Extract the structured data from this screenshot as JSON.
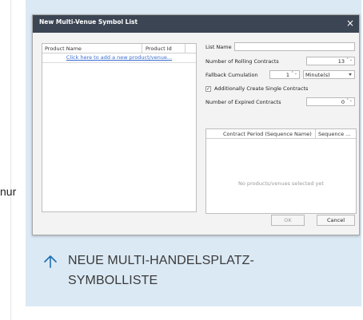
{
  "background": {
    "panel_color": "#dbe9f4",
    "cut_text": "nur"
  },
  "dialog": {
    "title": "New Multi-Venue Symbol List",
    "close_glyph": "×",
    "titlebar_color": "#3b4553",
    "products_grid": {
      "columns": [
        "Product Name",
        "Product Id"
      ],
      "add_row_link": "Click here to add a new product/venue..."
    },
    "form": {
      "list_name_label": "List Name",
      "list_name_value": "",
      "rolling_contracts_label": "Number of Rolling Contracts",
      "rolling_contracts_value": "13",
      "fallback_label": "Fallback Cumulation",
      "fallback_value": "1",
      "fallback_unit": "Minute(s)",
      "single_contracts_label": "Additionally Create Single Contracts",
      "single_contracts_checked": "✓",
      "expired_contracts_label": "Number of Expired Contracts",
      "expired_contracts_value": "0"
    },
    "contract_grid": {
      "columns": [
        "Contract Period (Sequence Name)",
        "Sequence ..."
      ],
      "empty_text": "No products/venues selected yet"
    },
    "buttons": {
      "ok": "OK",
      "cancel": "Cancel"
    },
    "spinner_glyph": "⌃⌄"
  },
  "caption": {
    "icon": "arrow-up-icon",
    "line1": "NEUE MULTI-HANDELSPLATZ-",
    "line2": "SYMBOLLISTE",
    "color": "#1f6fb2"
  }
}
